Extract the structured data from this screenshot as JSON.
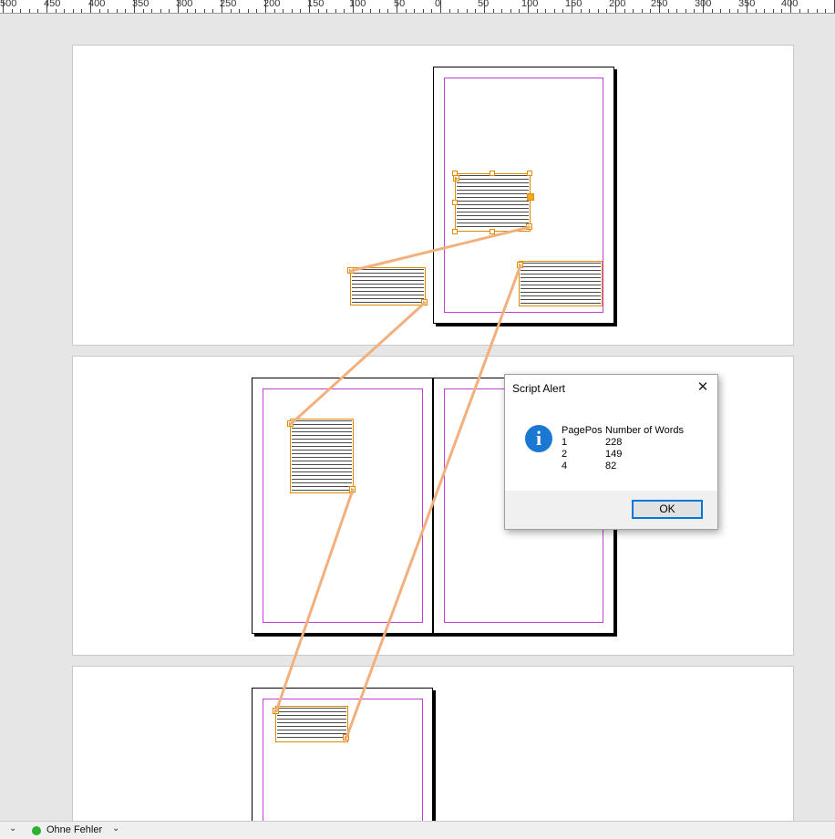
{
  "ruler": {
    "labels": [
      "500",
      "450",
      "400",
      "350",
      "300",
      "250",
      "200",
      "150",
      "100",
      "50",
      "0",
      "50",
      "100",
      "150",
      "200",
      "250",
      "300",
      "350",
      "400"
    ]
  },
  "dialog": {
    "title": "Script Alert",
    "close_symbol": "✕",
    "icon": "info-icon",
    "icon_glyph": "i",
    "columns": [
      "PagePos",
      "Number of Words"
    ],
    "rows": [
      {
        "page_pos": "1",
        "words": "228"
      },
      {
        "page_pos": "2",
        "words": "149"
      },
      {
        "page_pos": "4",
        "words": "82"
      }
    ],
    "ok_label": "OK"
  },
  "statusbar": {
    "status_text": "Ohne Fehler",
    "status_color": "#2eb12e"
  },
  "colors": {
    "thread": "#f4b07c",
    "margin_guide": "#c43fd9",
    "frame_selection": "#e08a00",
    "dialog_accent": "#0078d7"
  }
}
